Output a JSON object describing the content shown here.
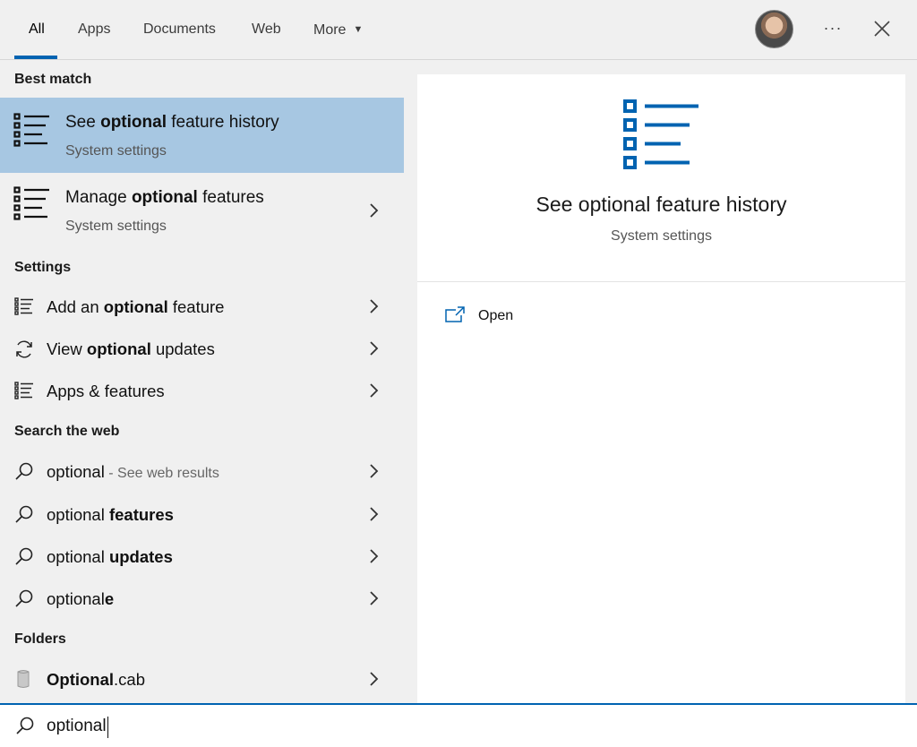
{
  "tabs": [
    {
      "label": "All"
    },
    {
      "label": "Apps"
    },
    {
      "label": "Documents"
    },
    {
      "label": "Web"
    },
    {
      "label": "More"
    }
  ],
  "header_icons": {
    "more_options": "ellipsis-icon",
    "close": "close-icon",
    "avatar": "user-avatar"
  },
  "sections": {
    "best_match": "Best match",
    "settings": "Settings",
    "search_web": "Search the web",
    "folders": "Folders"
  },
  "best_match": {
    "pre": "See ",
    "bold": "optional",
    "post": " feature history",
    "sub": "System settings"
  },
  "manage": {
    "pre": "Manage ",
    "bold": "optional",
    "post": " features",
    "sub": "System settings"
  },
  "settings_items": [
    {
      "pre": "Add an ",
      "bold": "optional",
      "post": " feature",
      "icon": "list-icon"
    },
    {
      "pre": "View ",
      "bold": "optional",
      "post": " updates",
      "icon": "refresh-icon"
    },
    {
      "pre": "Apps & features",
      "bold": "",
      "post": "",
      "icon": "list-icon"
    }
  ],
  "web_items": [
    {
      "pre": "optional",
      "bold": "",
      "post": "",
      "muted": " - See web results"
    },
    {
      "pre": "optional ",
      "bold": "features",
      "post": "",
      "muted": ""
    },
    {
      "pre": "optional ",
      "bold": "updates",
      "post": "",
      "muted": ""
    },
    {
      "pre": "optional",
      "bold": "e",
      "post": "",
      "muted": ""
    }
  ],
  "folder_item": {
    "bold": "Optional",
    "post": ".cab"
  },
  "preview": {
    "title": "See optional feature history",
    "sub": "System settings",
    "action_label": "Open",
    "accent": "#0063b1"
  },
  "search": {
    "query": "optional"
  },
  "colors": {
    "selection": "#a7c7e2",
    "accent": "#0063b1",
    "panel": "#f0f0f0"
  }
}
